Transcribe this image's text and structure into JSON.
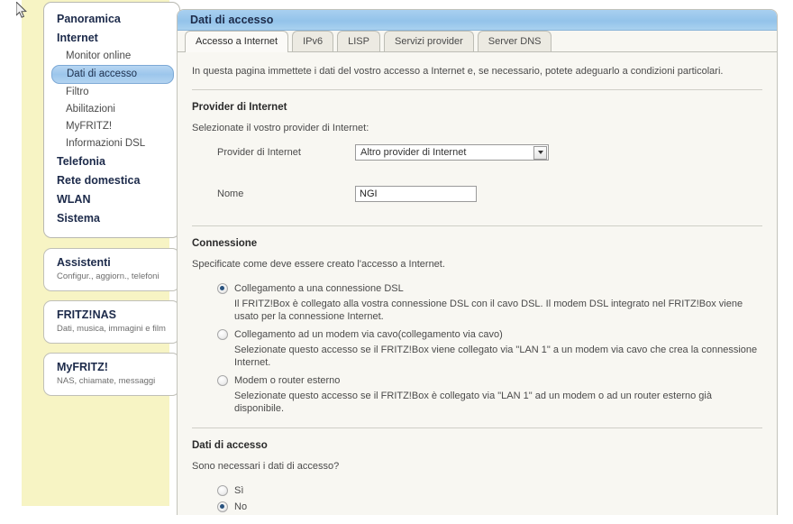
{
  "sidebar": {
    "nav": [
      {
        "label": "Panoramica",
        "level": "top",
        "selected": false
      },
      {
        "label": "Internet",
        "level": "top",
        "selected": false
      },
      {
        "label": "Monitor online",
        "level": "sub",
        "selected": false
      },
      {
        "label": "Dati di accesso",
        "level": "sub",
        "selected": true
      },
      {
        "label": "Filtro",
        "level": "sub",
        "selected": false
      },
      {
        "label": "Abilitazioni",
        "level": "sub",
        "selected": false
      },
      {
        "label": "MyFRITZ!",
        "level": "sub",
        "selected": false
      },
      {
        "label": "Informazioni DSL",
        "level": "sub",
        "selected": false
      },
      {
        "label": "Telefonia",
        "level": "top",
        "selected": false
      },
      {
        "label": "Rete domestica",
        "level": "top",
        "selected": false
      },
      {
        "label": "WLAN",
        "level": "top",
        "selected": false
      },
      {
        "label": "Sistema",
        "level": "top",
        "selected": false
      }
    ],
    "cards": [
      {
        "title": "Assistenti",
        "subtitle": "Configur., aggiorn., telefoni"
      },
      {
        "title": "FRITZ!NAS",
        "subtitle": "Dati, musica, immagini e film"
      },
      {
        "title": "MyFRITZ!",
        "subtitle": "NAS, chiamate, messaggi"
      }
    ]
  },
  "panel": {
    "title": "Dati di accesso",
    "tabs": [
      {
        "label": "Accesso a Internet",
        "active": true
      },
      {
        "label": "IPv6",
        "active": false
      },
      {
        "label": "LISP",
        "active": false
      },
      {
        "label": "Servizi provider",
        "active": false
      },
      {
        "label": "Server DNS",
        "active": false
      }
    ],
    "intro": "In questa pagina immettete i dati del vostro accesso a Internet e, se necessario, potete adeguarlo a condizioni particolari.",
    "provider_section": {
      "title": "Provider di Internet",
      "subtitle": "Selezionate il vostro provider di Internet:",
      "provider_label": "Provider di Internet",
      "provider_value": "Altro provider di Internet",
      "name_label": "Nome",
      "name_value": "NGI",
      "name_placeholder": ""
    },
    "connection_section": {
      "title": "Connessione",
      "subtitle": "Specificate come deve essere creato l'accesso a Internet.",
      "options": [
        {
          "label": "Collegamento a una connessione DSL",
          "checked": true,
          "description": "Il FRITZ!Box è collegato alla vostra connessione DSL con il cavo DSL. Il modem DSL integrato nel FRITZ!Box viene usato per la connessione Internet."
        },
        {
          "label": "Collegamento ad un modem via cavo(collegamento via cavo)",
          "checked": false,
          "description": "Selezionate questo accesso se il FRITZ!Box viene collegato via \"LAN 1\" a un modem via cavo che crea la connessione Internet."
        },
        {
          "label": "Modem o router esterno",
          "checked": false,
          "description": "Selezionate questo accesso se il FRITZ!Box è collegato via \"LAN 1\" ad un modem o ad un router esterno già disponibile."
        }
      ]
    },
    "access_section": {
      "title": "Dati di accesso",
      "subtitle": "Sono necessari i dati di accesso?",
      "options": [
        {
          "label": "Sì",
          "checked": false
        },
        {
          "label": "No",
          "checked": true
        }
      ]
    }
  },
  "colors": {
    "header_blue": "#93c3ea",
    "sidebar_yellow": "#f7f4c4",
    "selected_nav": "#9cc6ec",
    "radio_dot": "#28527e",
    "content_bg": "#f8f7f2"
  }
}
